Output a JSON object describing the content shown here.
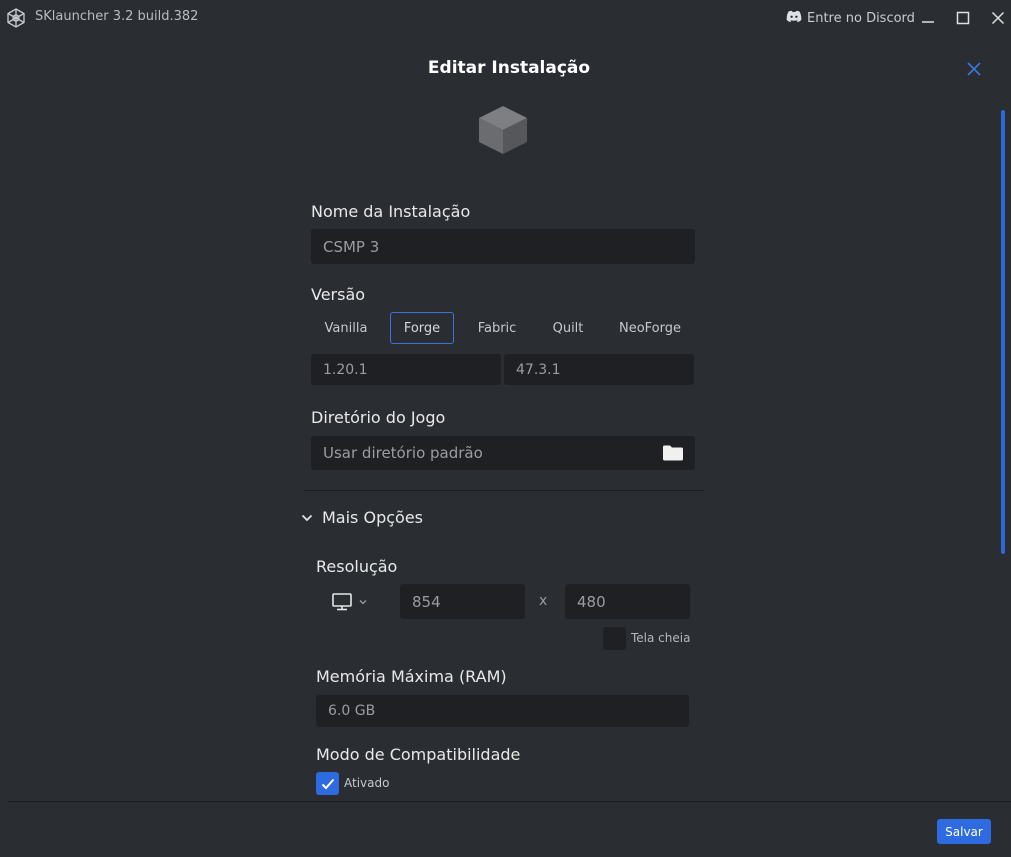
{
  "window": {
    "title": "SKlauncher 3.2 build.382",
    "discord_label": "Entre no Discord"
  },
  "dialog": {
    "title": "Editar Instalação",
    "name_label": "Nome da Instalação",
    "name_value": "CSMP 3",
    "version_label": "Versão",
    "loaders": [
      "Vanilla",
      "Forge",
      "Fabric",
      "Quilt",
      "NeoForge"
    ],
    "selected_loader": "Forge",
    "mc_version": "1.20.1",
    "loader_version": "47.3.1",
    "directory_label": "Diretório do Jogo",
    "directory_placeholder": "Usar diretório padrão",
    "more_options_label": "Mais Opções",
    "resolution_label": "Resolução",
    "width": "854",
    "separator": "x",
    "height": "480",
    "fullscreen_label": "Tela cheia",
    "fullscreen_checked": false,
    "memory_label": "Memória Máxima (RAM)",
    "memory_value": "6.0 GB",
    "compat_label": "Modo de Compatibilidade",
    "compat_option": "Ativado",
    "compat_checked": true,
    "save_label": "Salvar"
  },
  "colors": {
    "background": "#2a2d32",
    "input_background": "#1e2024",
    "accent": "#2f6be0"
  }
}
